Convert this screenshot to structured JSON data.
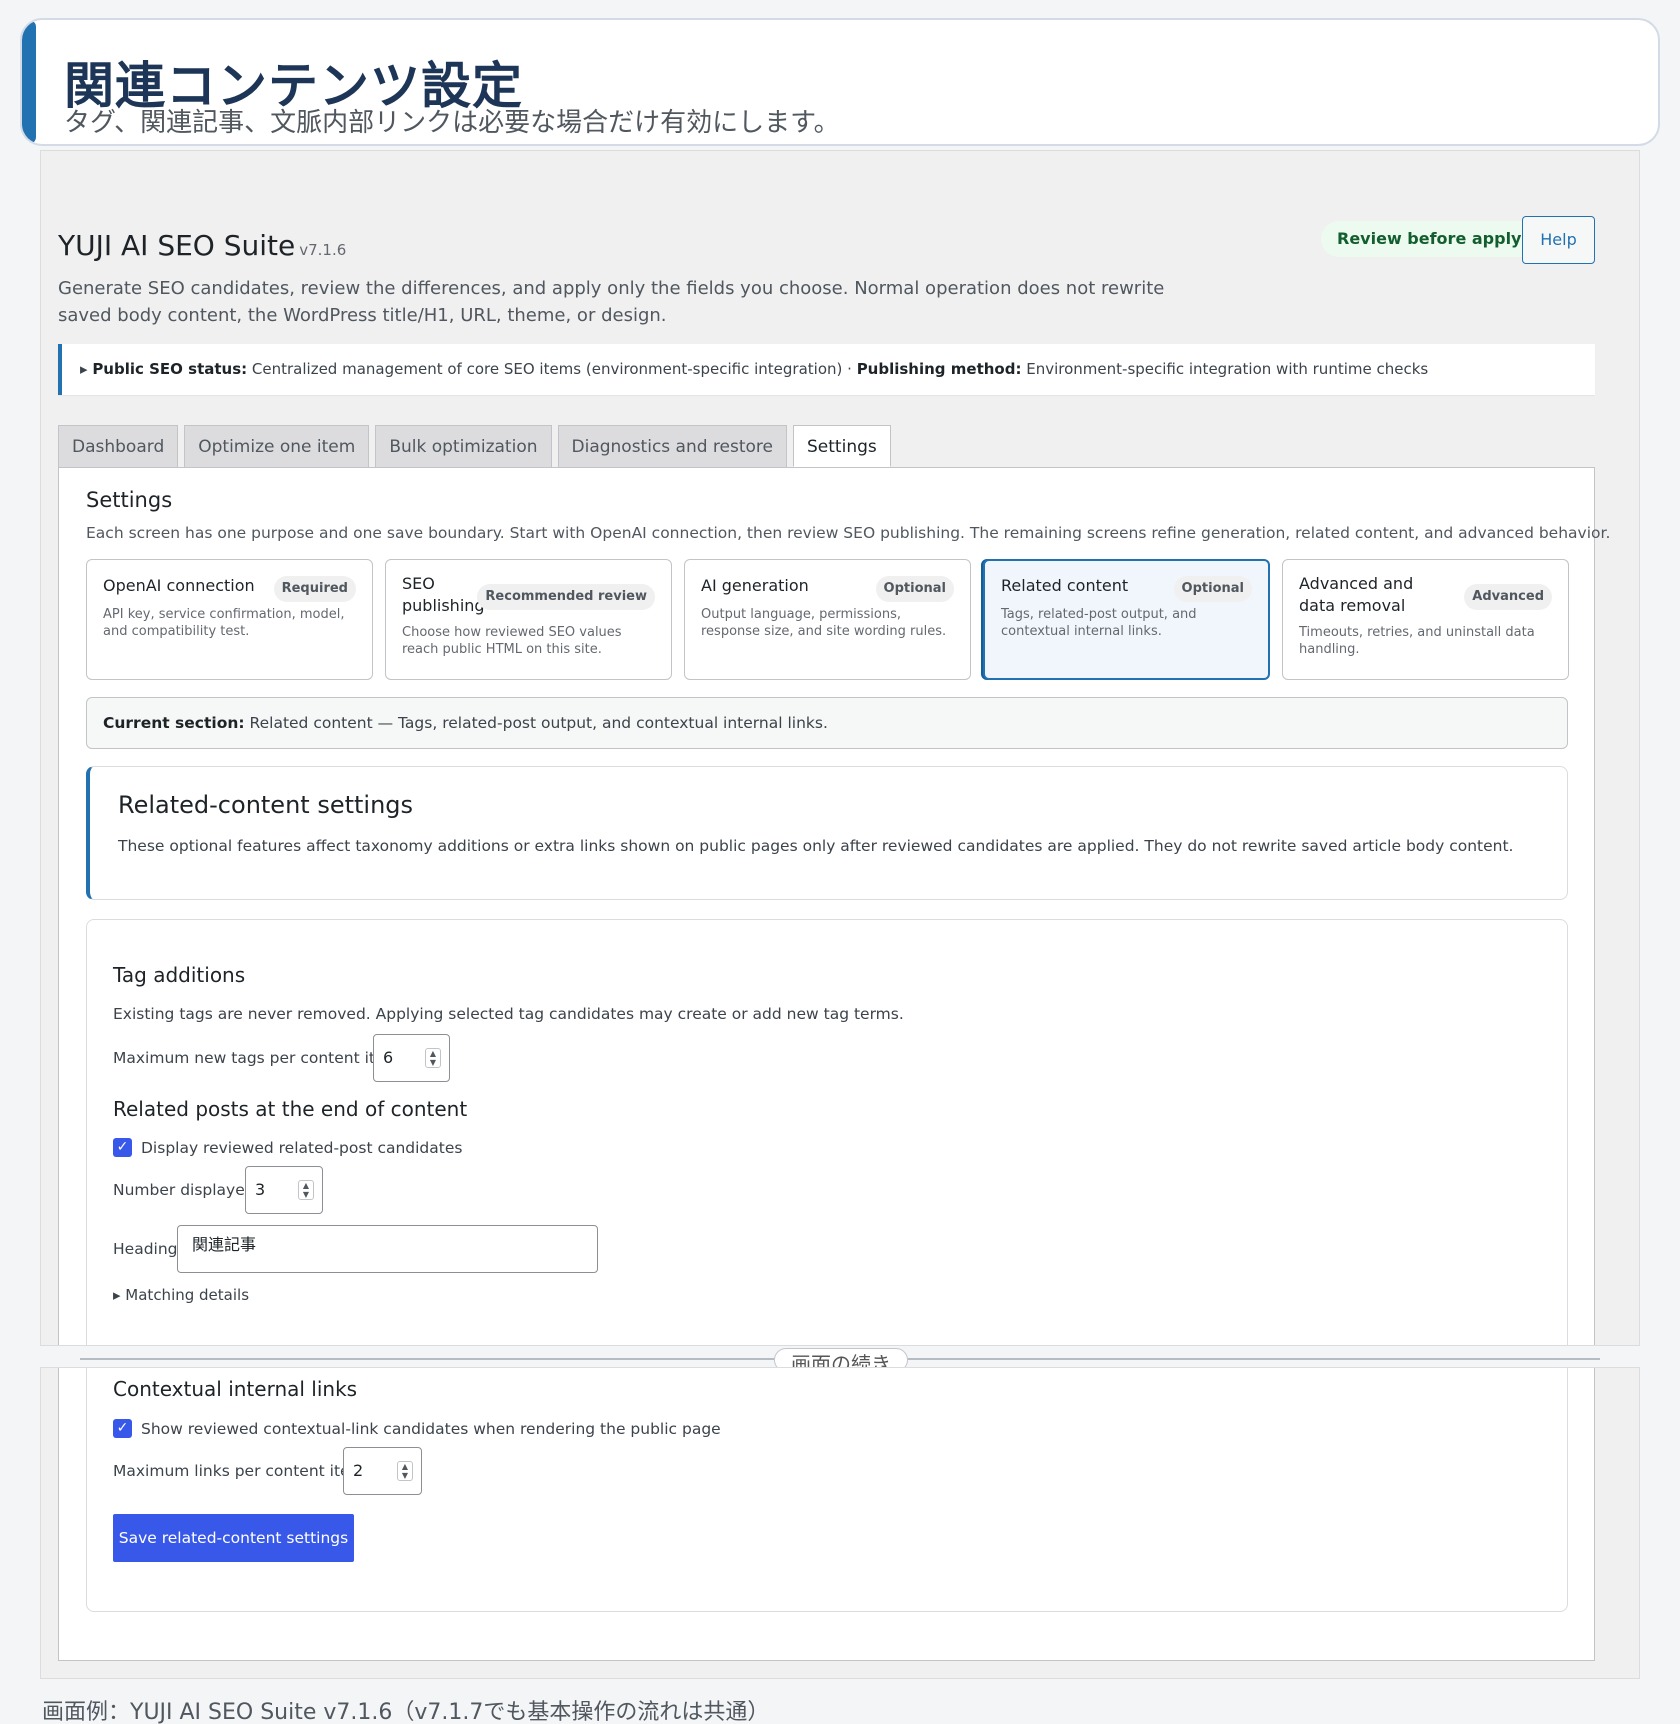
{
  "banner": {
    "title": "関連コンテンツ設定",
    "subtitle": "タグ、関連記事、文脈内部リンクは必要な場合だけ有効にします。"
  },
  "header": {
    "app_name": "YUJI AI SEO Suite",
    "version": "v7.1.6",
    "review_badge": "Review before applying",
    "help_label": "Help",
    "description": "Generate SEO candidates, review the differences, and apply only the fields you choose. Normal operation does not rewrite saved body content, the WordPress title/H1, URL, theme, or design."
  },
  "notice": {
    "marker": "▸",
    "status_label": "Public SEO status:",
    "status_value": "Centralized management of core SEO items (environment-specific integration) ·",
    "method_label": "Publishing method:",
    "method_value": "Environment-specific integration with runtime checks"
  },
  "tabs": [
    {
      "label": "Dashboard",
      "active": false
    },
    {
      "label": "Optimize one item",
      "active": false
    },
    {
      "label": "Bulk optimization",
      "active": false
    },
    {
      "label": "Diagnostics and restore",
      "active": false
    },
    {
      "label": "Settings",
      "active": true
    }
  ],
  "settings": {
    "title": "Settings",
    "description": "Each screen has one purpose and one save boundary. Start with OpenAI connection, then review SEO publishing. The remaining screens refine generation, related content, and advanced behavior.",
    "cards": [
      {
        "title": "OpenAI connection",
        "badge": "Required",
        "desc": "API key, service confirmation, model, and compatibility test.",
        "active": false
      },
      {
        "title": "SEO publishing",
        "badge": "Recommended review",
        "desc": "Choose how reviewed SEO values reach public HTML on this site.",
        "active": false
      },
      {
        "title": "AI generation",
        "badge": "Optional",
        "desc": "Output language, permissions, response size, and site wording rules.",
        "active": false
      },
      {
        "title": "Related content",
        "badge": "Optional",
        "desc": "Tags, related-post output, and contextual internal links.",
        "active": true
      },
      {
        "title": "Advanced and data removal",
        "badge": "Advanced",
        "desc": "Timeouts, retries, and uninstall data handling.",
        "active": false
      }
    ],
    "current_label": "Current section:",
    "current_value": "Related content — Tags, related-post output, and contextual internal links."
  },
  "related_content": {
    "title": "Related-content settings",
    "description": "These optional features affect taxonomy additions or extra links shown on public pages only after reviewed candidates are applied. They do not rewrite saved article body content."
  },
  "tag_additions": {
    "title": "Tag additions",
    "description": "Existing tags are never removed. Applying selected tag candidates may create or add new tag terms.",
    "max_label": "Maximum new tags per content item",
    "max_value": "6"
  },
  "related_posts": {
    "title": "Related posts at the end of content",
    "display_label": "Display reviewed related-post candidates",
    "display_checked": true,
    "number_label": "Number displayed",
    "number_value": "3",
    "heading_label": "Heading",
    "heading_value": "関連記事",
    "details_label": "▸ Matching details"
  },
  "divider": {
    "label": "画面の続き"
  },
  "contextual_links": {
    "title": "Contextual internal links",
    "show_label": "Show reviewed contextual-link candidates when rendering the public page",
    "show_checked": true,
    "max_label": "Maximum links per content item",
    "max_value": "2",
    "save_label": "Save related-content settings"
  },
  "caption": "画面例：YUJI AI SEO Suite v7.1.6（v7.1.7でも基本操作の流れは共通）",
  "colors": {
    "accent": "#2271b1",
    "primary_button": "#3858e9",
    "review_badge_bg": "#edfaef",
    "review_badge_text": "#135e2e"
  }
}
